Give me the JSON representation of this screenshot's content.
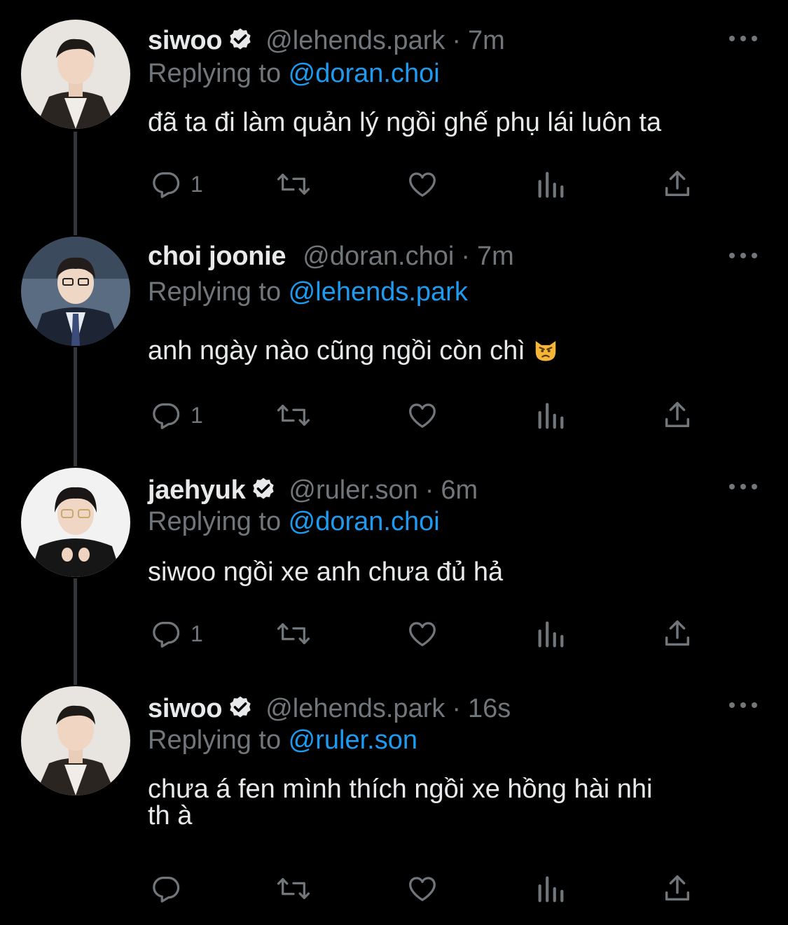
{
  "tweets": [
    {
      "name": "siwoo",
      "verified": true,
      "handle": "@lehends.park",
      "sep": "·",
      "time": "7m",
      "replying_label": "Replying to ",
      "replying_to": "@doran.choi",
      "text": "đã ta đi làm quản lý ngồi ghế phụ lái luôn ta",
      "reply_count": "1"
    },
    {
      "name": "choi joonie",
      "verified": false,
      "handle": "@doran.choi",
      "sep": "·",
      "time": "7m",
      "replying_label": "Replying to ",
      "replying_to": "@lehends.park",
      "text": "anh ngày nào cũng ngồi còn chì",
      "emoji": "angry-cat-emoji",
      "reply_count": "1"
    },
    {
      "name": "jaehyuk",
      "verified": true,
      "handle": "@ruler.son",
      "sep": "·",
      "time": "6m",
      "replying_label": "Replying to ",
      "replying_to": "@doran.choi",
      "text": "siwoo ngồi xe anh chưa đủ hả",
      "reply_count": "1"
    },
    {
      "name": "siwoo",
      "verified": true,
      "handle": "@lehends.park",
      "sep": "·",
      "time": "16s",
      "replying_label": "Replying to ",
      "replying_to": "@ruler.son",
      "text_line1": "chưa á fen mình thích ngồi xe hồng hài nhi",
      "text_line2": "th à",
      "reply_count": ""
    }
  ],
  "colors": {
    "background": "#000000",
    "text": "#e7e9ea",
    "muted": "#71767b",
    "link": "#1d9bf0",
    "thread_line": "#333639"
  },
  "icons": [
    "reply-icon",
    "retweet-icon",
    "like-icon",
    "views-icon",
    "share-icon",
    "more-icon",
    "verified-icon"
  ]
}
